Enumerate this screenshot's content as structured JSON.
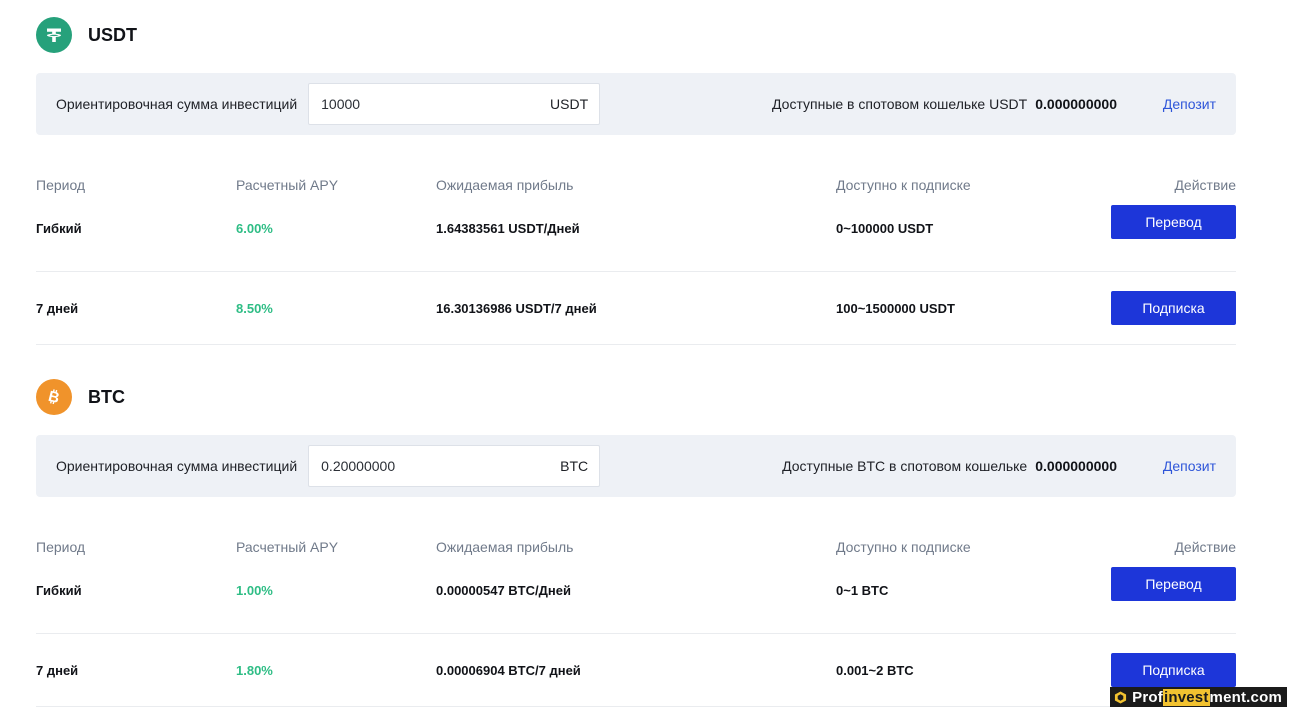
{
  "colors": {
    "usdt_logo": "#26a17b",
    "btc_logo": "#f0932b",
    "apy_green": "#2ebd85",
    "button_blue": "#1d36d9",
    "link_blue": "#2f56d9",
    "panel_bg": "#eef1f6"
  },
  "usdt": {
    "icon": "tether-icon",
    "name": "USDT",
    "calc_label": "Ориентировочная сумма инвестиций",
    "amount_value": "10000",
    "amount_unit": "USDT",
    "wallet_label": "Доступные в спотовом кошельке USDT",
    "wallet_value": "0.000000000",
    "deposit_label": "Депозит",
    "headers": [
      "Период",
      "Расчетный APY",
      "Ожидаемая прибыль",
      "Доступно к подписке",
      "Действие"
    ],
    "rows": [
      {
        "period": "Гибкий",
        "apy": "6.00%",
        "profit": "1.64383561 USDT/Дней",
        "available": "0~100000 USDT",
        "action": "Перевод"
      },
      {
        "period": "7 дней",
        "apy": "8.50%",
        "profit": "16.30136986 USDT/7 дней",
        "available": "100~1500000 USDT",
        "action": "Подписка"
      }
    ]
  },
  "btc": {
    "icon": "bitcoin-icon",
    "name": "BTC",
    "calc_label": "Ориентировочная сумма инвестиций",
    "amount_value": "0.20000000",
    "amount_unit": "BTC",
    "wallet_label": "Доступные BTC в спотовом кошельке",
    "wallet_value": "0.000000000",
    "deposit_label": "Депозит",
    "headers": [
      "Период",
      "Расчетный APY",
      "Ожидаемая прибыль",
      "Доступно к подписке",
      "Действие"
    ],
    "rows": [
      {
        "period": "Гибкий",
        "apy": "1.00%",
        "profit": "0.00000547 BTC/Дней",
        "available": "0~1 BTC",
        "action": "Перевод"
      },
      {
        "period": "7 дней",
        "apy": "1.80%",
        "profit": "0.00006904 BTC/7 дней",
        "available": "0.001~2 BTC",
        "action": "Подписка"
      }
    ]
  },
  "watermark": {
    "prefix": "Prof",
    "highlight": "invest",
    "suffix": "ment.com"
  }
}
